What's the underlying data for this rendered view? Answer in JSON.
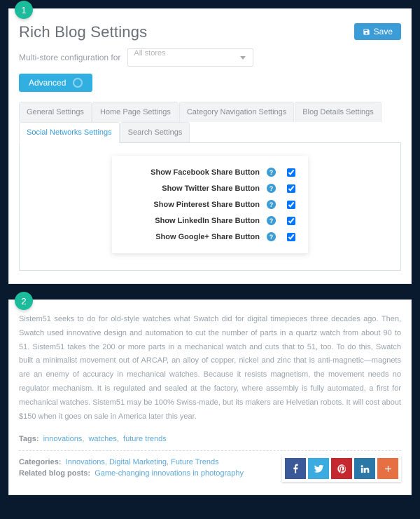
{
  "panel1": {
    "badge": "1",
    "title": "Rich Blog Settings",
    "btn_save": "Save",
    "store_label": "Multi-store configuration for",
    "store_value": "All stores",
    "advanced": "Advanced",
    "tabs": {
      "t0": "General Settings",
      "t1": "Home Page Settings",
      "t2": "Category Navigation Settings",
      "t3": "Blog Details Settings",
      "t4": "Social Networks Settings",
      "t5": "Search Settings"
    },
    "settings": {
      "s0": "Show Facebook Share Button",
      "s1": "Show Twitter Share Button",
      "s2": "Show Pinterest Share Button",
      "s3": "Show LinkedIn Share Button",
      "s4": "Show Google+ Share Button"
    }
  },
  "panel2": {
    "badge": "2",
    "article": "Sistem51 seeks to do for old-style watches what Swatch did for digital timepieces three decades ago. Then, Swatch used innovative design and automation to cut the number of parts in a quartz watch from about 90 to 51. Sistem51 takes the 200 or more parts in a mechanical watch and cuts that to 51, too. To do this, Swatch built a minimalist movement out of ARCAP, an alloy of copper, nickel and zinc that is anti-magnetic—magnets are an enemy of accuracy in mechanical watches. Because it resists magnetism, the movement needs no regulator mechanism. It is regulated and sealed at the factory, where assembly is fully automated, a first for mechanical watches. Sistem51 may be 100% Swiss-made, but its makers are Helvetian robots. It will cost about $150 when it goes on sale in America later this year.",
    "tags_label": "Tags:",
    "tags": {
      "t0": "innovations",
      "t1": "watches",
      "t2": "future trends"
    },
    "cats_label": "Categories:",
    "cats": {
      "c0": "Innovations",
      "c1": "Digital Marketing",
      "c2": "Future Trends"
    },
    "related_label": "Related blog posts:",
    "related_link": "Game-changing innovations in photography"
  }
}
